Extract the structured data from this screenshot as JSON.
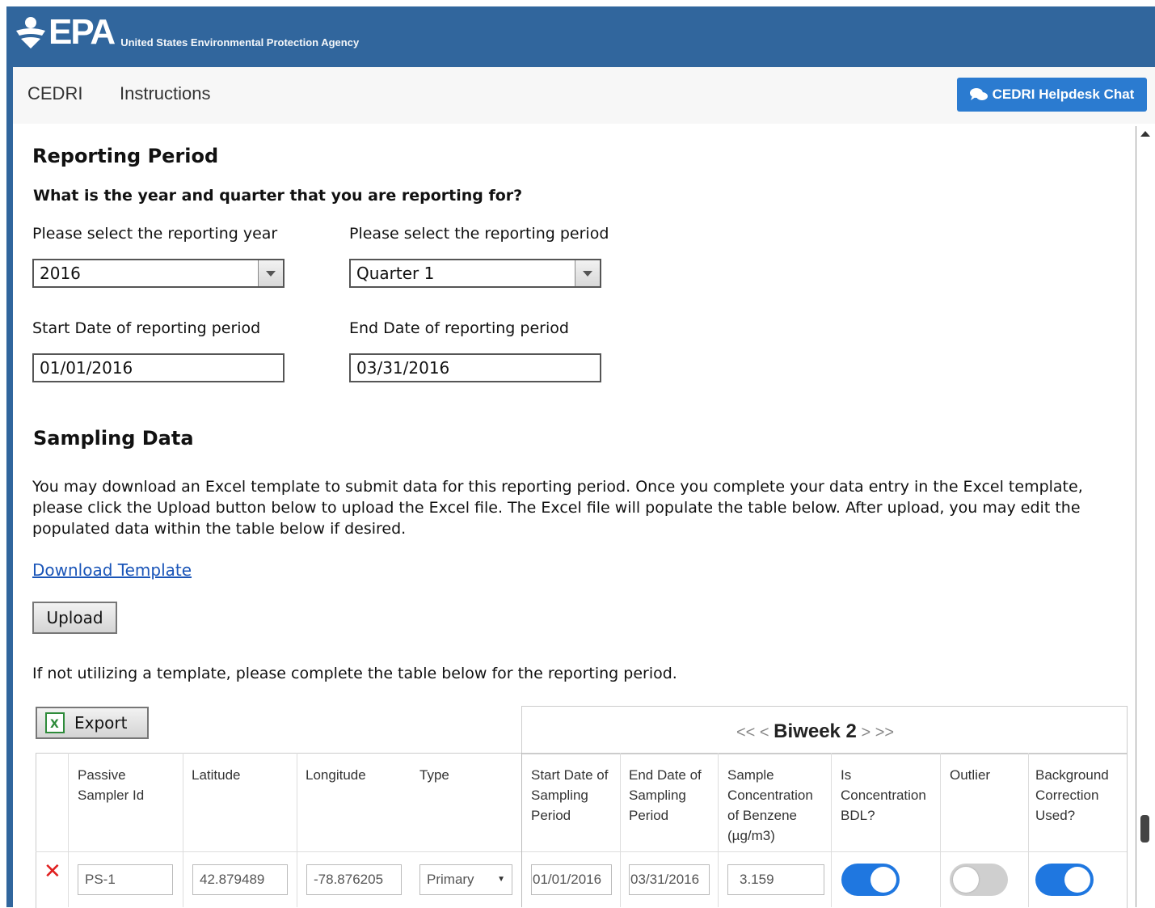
{
  "header": {
    "logo_text": "EPA",
    "agency": "United States Environmental Protection Agency"
  },
  "nav": {
    "items": [
      "CEDRI",
      "Instructions"
    ],
    "chat_button": "CEDRI Helpdesk Chat"
  },
  "reporting": {
    "title": "Reporting Period",
    "question": "What is the year and quarter that you are reporting for?",
    "year_label": "Please select the reporting year",
    "year_value": "2016",
    "period_label": "Please select the reporting period",
    "period_value": "Quarter 1",
    "start_label": "Start Date of reporting period",
    "start_value": "01/01/2016",
    "end_label": "End Date of reporting period",
    "end_value": "03/31/2016"
  },
  "sampling": {
    "title": "Sampling Data",
    "description": "You may download an Excel template to submit data for this reporting period. Once you complete your data entry in the Excel template, please click the Upload button below to upload the Excel file. The Excel file will populate the table below. After upload, you may edit the populated data within the table below if desired.",
    "download_link": "Download Template",
    "upload_button": "Upload",
    "no_template_note": "If not utilizing a template, please complete the table below for the reporting period."
  },
  "table": {
    "export_button": "Export",
    "pager": {
      "first": "<<",
      "prev": "<",
      "label": "Biweek 2",
      "next": ">",
      "last": ">>"
    },
    "columns": [
      "Passive Sampler Id",
      "Latitude",
      "Longitude",
      "Type",
      "Start Date of Sampling Period",
      "End Date of Sampling Period",
      "Sample Concentration of Benzene (µg/m3)",
      "Is Concentration BDL?",
      "Outlier",
      "Background Correction Used?"
    ],
    "rows": [
      {
        "sampler_id": "PS-1",
        "latitude": "42.879489",
        "longitude": "-78.876205",
        "type": "Primary",
        "start": "01/01/2016",
        "end": "03/31/2016",
        "concentration": "3.159",
        "bdl": true,
        "outlier": false,
        "background_correction": true
      }
    ]
  },
  "colors": {
    "header_blue": "#31669d",
    "button_blue": "#2b7bd0",
    "toggle_on": "#1f77e0",
    "delete_red": "#e01f1f",
    "link": "#1a55b8"
  }
}
